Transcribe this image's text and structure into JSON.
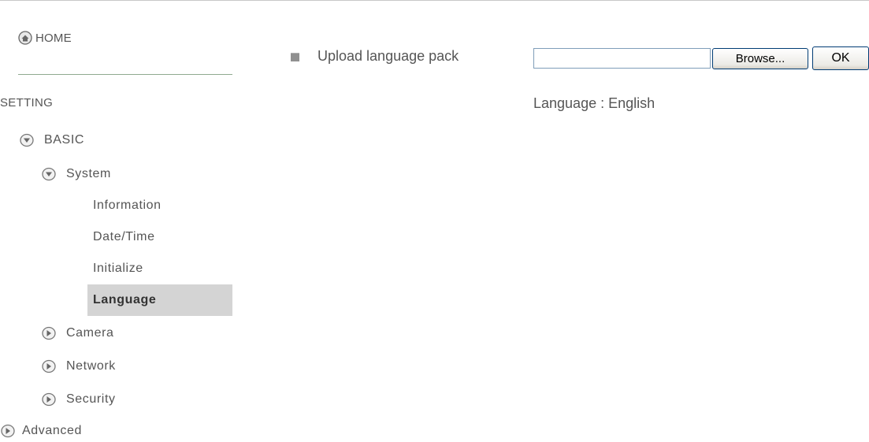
{
  "sidebar": {
    "home_label": "HOME",
    "section_label": "SETTING",
    "basic_label": "BASIC",
    "system_label": "System",
    "system_items": [
      "Information",
      "Date/Time",
      "Initialize",
      "Language"
    ],
    "active_item": "Language",
    "basic_children": [
      "Camera",
      "Network",
      "Security"
    ],
    "advanced_label": "Advanced"
  },
  "main": {
    "upload_label": "Upload language pack",
    "file_value": "",
    "browse_label": "Browse...",
    "ok_label": "OK",
    "language_status": "Language : English"
  },
  "colors": {
    "text": "#555555",
    "active_bg": "#d4d4d4",
    "separator": "#8faa8f",
    "button_border": "#003c74"
  },
  "icons": {
    "home": "home-icon",
    "expanded": "chevron-down-circle-icon",
    "collapsed": "chevron-right-circle-icon",
    "bullet": "square-bullet-icon"
  }
}
